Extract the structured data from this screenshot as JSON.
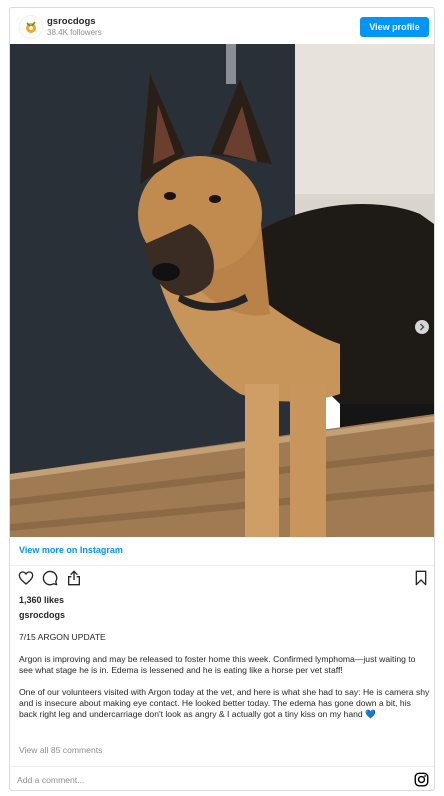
{
  "post": {
    "username": "gsrocdogs",
    "followers": "38.4K followers",
    "view_profile_label": "View profile",
    "view_more_label": "View more on Instagram",
    "likes": "1,360 likes",
    "caption_user": "gsrocdogs",
    "caption_paragraphs": [
      "7/15 ARGON UPDATE",
      "Argon is improving and may be released to foster home this week. Confirmed lymphoma—just waiting to see what stage he is in. Edema is lessened and he is eating like a horse per vet staff!",
      "One of our volunteers visited with Argon today at the vet, and here is what she had to say: He is camera shy and is insecure about making eye contact. He looked better today. The edema has gone down a bit, his back right leg and undercarriage don't look as angry & I actually got a tiny kiss on my hand 💙"
    ],
    "view_comments": "View all 85 comments",
    "comment_placeholder": "Add a comment...",
    "carousel": {
      "slide_count": 2,
      "active_slide": 1
    },
    "colors": {
      "accent": "#0095f6",
      "muted": "#8e8e8e",
      "text": "#262626"
    },
    "icons": [
      "heart-icon",
      "comment-icon",
      "share-icon",
      "bookmark-icon",
      "instagram-icon",
      "chevron-right-icon"
    ]
  }
}
